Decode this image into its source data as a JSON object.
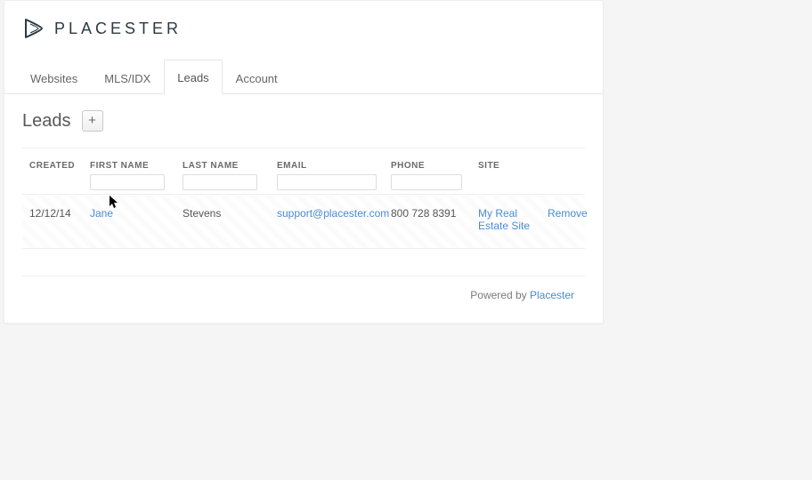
{
  "brand": {
    "name": "PLACESTER"
  },
  "tabs": [
    {
      "label": "Websites",
      "active": false
    },
    {
      "label": "MLS/IDX",
      "active": false
    },
    {
      "label": "Leads",
      "active": true
    },
    {
      "label": "Account",
      "active": false
    }
  ],
  "page": {
    "title": "Leads",
    "add_button": "+"
  },
  "columns": {
    "created": "CREATED",
    "firstname": "FIRST NAME",
    "lastname": "LAST NAME",
    "email": "EMAIL",
    "phone": "PHONE",
    "site": "SITE"
  },
  "filters": {
    "firstname": "",
    "lastname": "",
    "email": "",
    "phone": ""
  },
  "rows": [
    {
      "created": "12/12/14",
      "firstname": "Jane",
      "lastname": "Stevens",
      "email": "support@placester.com",
      "phone": "800 728 8391",
      "site": "My Real Estate Site",
      "action": "Remove"
    }
  ],
  "footer": {
    "prefix": "Powered by ",
    "link": "Placester"
  }
}
